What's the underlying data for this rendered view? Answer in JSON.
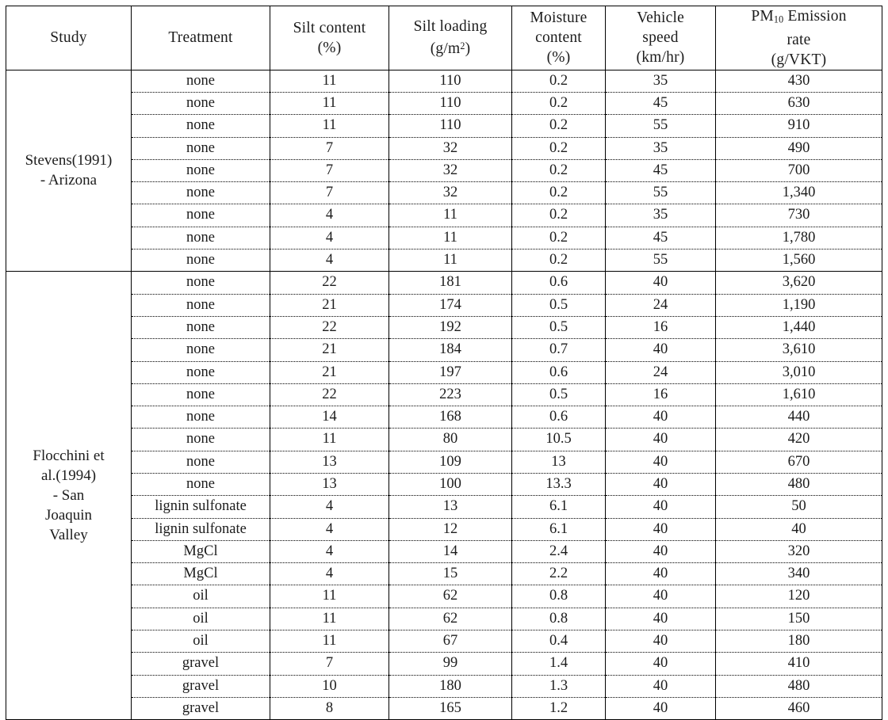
{
  "table": {
    "headers": [
      {
        "id": "study",
        "lines": [
          "Study"
        ]
      },
      {
        "id": "treatment",
        "lines": [
          "Treatment"
        ]
      },
      {
        "id": "silt_content",
        "lines": [
          "Silt content",
          "(%)"
        ]
      },
      {
        "id": "silt_loading",
        "lines": [
          "Silt loading",
          "(g/m2)"
        ]
      },
      {
        "id": "moisture_content",
        "lines": [
          "Moisture",
          "content",
          "(%)"
        ]
      },
      {
        "id": "vehicle_speed",
        "lines": [
          "Vehicle",
          "speed",
          "(km/hr)"
        ]
      },
      {
        "id": "pm10_emission_rate",
        "lines": [
          "PM10 Emission",
          "rate",
          "(g/VKT)"
        ]
      }
    ],
    "header_text": {
      "study": "Study",
      "treatment": "Treatment",
      "silt_content_1": "Silt  content",
      "silt_content_2": "(%)",
      "silt_loading_1": "Silt   loading",
      "silt_loading_2a": "(g/m",
      "silt_loading_2b": "2",
      "silt_loading_2c": ")",
      "moisture_1": "Moisture",
      "moisture_2": "content",
      "moisture_3": "(%)",
      "speed_1": "Vehicle",
      "speed_2": "speed",
      "speed_3": "(km/hr)",
      "pm10_1a": "PM",
      "pm10_1b": "10",
      "pm10_1c": " Emission",
      "pm10_2": "rate",
      "pm10_3": "(g/VKT)"
    },
    "groups": [
      {
        "study_lines": [
          "Stevens(1991)",
          "- Arizona"
        ],
        "study_label": "Stevens(1991) - Arizona",
        "rows": [
          {
            "treatment": "none",
            "silt_content": "11",
            "silt_loading": "110",
            "moisture": "0.2",
            "speed": "35",
            "pm10": "430"
          },
          {
            "treatment": "none",
            "silt_content": "11",
            "silt_loading": "110",
            "moisture": "0.2",
            "speed": "45",
            "pm10": "630"
          },
          {
            "treatment": "none",
            "silt_content": "11",
            "silt_loading": "110",
            "moisture": "0.2",
            "speed": "55",
            "pm10": "910"
          },
          {
            "treatment": "none",
            "silt_content": "7",
            "silt_loading": "32",
            "moisture": "0.2",
            "speed": "35",
            "pm10": "490"
          },
          {
            "treatment": "none",
            "silt_content": "7",
            "silt_loading": "32",
            "moisture": "0.2",
            "speed": "45",
            "pm10": "700"
          },
          {
            "treatment": "none",
            "silt_content": "7",
            "silt_loading": "32",
            "moisture": "0.2",
            "speed": "55",
            "pm10": "1,340"
          },
          {
            "treatment": "none",
            "silt_content": "4",
            "silt_loading": "11",
            "moisture": "0.2",
            "speed": "35",
            "pm10": "730"
          },
          {
            "treatment": "none",
            "silt_content": "4",
            "silt_loading": "11",
            "moisture": "0.2",
            "speed": "45",
            "pm10": "1,780"
          },
          {
            "treatment": "none",
            "silt_content": "4",
            "silt_loading": "11",
            "moisture": "0.2",
            "speed": "55",
            "pm10": "1,560"
          }
        ]
      },
      {
        "study_lines": [
          "Flocchini et",
          "al.(1994)",
          "- San",
          "Joaquin",
          "Valley"
        ],
        "study_label": "Flocchini et al.(1994) - San Joaquin Valley",
        "rows": [
          {
            "treatment": "none",
            "silt_content": "22",
            "silt_loading": "181",
            "moisture": "0.6",
            "speed": "40",
            "pm10": "3,620"
          },
          {
            "treatment": "none",
            "silt_content": "21",
            "silt_loading": "174",
            "moisture": "0.5",
            "speed": "24",
            "pm10": "1,190"
          },
          {
            "treatment": "none",
            "silt_content": "22",
            "silt_loading": "192",
            "moisture": "0.5",
            "speed": "16",
            "pm10": "1,440"
          },
          {
            "treatment": "none",
            "silt_content": "21",
            "silt_loading": "184",
            "moisture": "0.7",
            "speed": "40",
            "pm10": "3,610"
          },
          {
            "treatment": "none",
            "silt_content": "21",
            "silt_loading": "197",
            "moisture": "0.6",
            "speed": "24",
            "pm10": "3,010"
          },
          {
            "treatment": "none",
            "silt_content": "22",
            "silt_loading": "223",
            "moisture": "0.5",
            "speed": "16",
            "pm10": "1,610"
          },
          {
            "treatment": "none",
            "silt_content": "14",
            "silt_loading": "168",
            "moisture": "0.6",
            "speed": "40",
            "pm10": "440"
          },
          {
            "treatment": "none",
            "silt_content": "11",
            "silt_loading": "80",
            "moisture": "10.5",
            "speed": "40",
            "pm10": "420"
          },
          {
            "treatment": "none",
            "silt_content": "13",
            "silt_loading": "109",
            "moisture": "13",
            "speed": "40",
            "pm10": "670"
          },
          {
            "treatment": "none",
            "silt_content": "13",
            "silt_loading": "100",
            "moisture": "13.3",
            "speed": "40",
            "pm10": "480"
          },
          {
            "treatment": "lignin sulfonate",
            "silt_content": "4",
            "silt_loading": "13",
            "moisture": "6.1",
            "speed": "40",
            "pm10": "50"
          },
          {
            "treatment": "lignin sulfonate",
            "silt_content": "4",
            "silt_loading": "12",
            "moisture": "6.1",
            "speed": "40",
            "pm10": "40"
          },
          {
            "treatment": "MgCl",
            "silt_content": "4",
            "silt_loading": "14",
            "moisture": "2.4",
            "speed": "40",
            "pm10": "320"
          },
          {
            "treatment": "MgCl",
            "silt_content": "4",
            "silt_loading": "15",
            "moisture": "2.2",
            "speed": "40",
            "pm10": "340"
          },
          {
            "treatment": "oil",
            "silt_content": "11",
            "silt_loading": "62",
            "moisture": "0.8",
            "speed": "40",
            "pm10": "120"
          },
          {
            "treatment": "oil",
            "silt_content": "11",
            "silt_loading": "62",
            "moisture": "0.8",
            "speed": "40",
            "pm10": "150"
          },
          {
            "treatment": "oil",
            "silt_content": "11",
            "silt_loading": "67",
            "moisture": "0.4",
            "speed": "40",
            "pm10": "180"
          },
          {
            "treatment": "gravel",
            "silt_content": "7",
            "silt_loading": "99",
            "moisture": "1.4",
            "speed": "40",
            "pm10": "410"
          },
          {
            "treatment": "gravel",
            "silt_content": "10",
            "silt_loading": "180",
            "moisture": "1.3",
            "speed": "40",
            "pm10": "480"
          },
          {
            "treatment": "gravel",
            "silt_content": "8",
            "silt_loading": "165",
            "moisture": "1.2",
            "speed": "40",
            "pm10": "460"
          }
        ]
      }
    ]
  },
  "style": {
    "border_color": "#000000",
    "text_color": "#1c1c1c",
    "background": "#ffffff"
  }
}
